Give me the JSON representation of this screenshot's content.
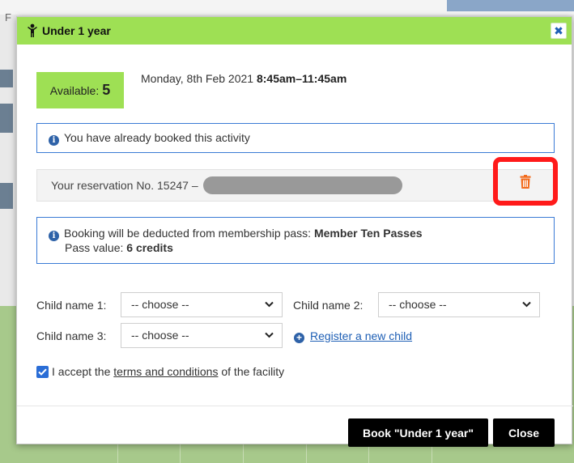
{
  "background": {
    "partial_text": "F",
    "grid_columns": 6
  },
  "dialog": {
    "title": "Under 1 year",
    "title_icon": "child-figure-icon",
    "close_icon": "close-x-icon",
    "available_label": "Available:",
    "available_count": "5",
    "date": "Monday, 8th Feb 2021",
    "time": "8:45am–11:45am",
    "already_booked": "You have already booked this activity",
    "reservation_text": "Your reservation No. 15247 –",
    "deduct_text": "Booking will be deducted from membership pass:",
    "pass_name": "Member Ten Passes",
    "pass_value_label": "Pass value:",
    "pass_value": "6 credits",
    "child1_label": "Child name 1:",
    "child2_label": "Child name 2:",
    "child3_label": "Child name 3:",
    "choose_placeholder": "-- choose --",
    "register_link": "Register a new child",
    "accept_prefix": "I accept the",
    "accept_link": "terms and conditions",
    "accept_suffix": "of the facility",
    "accept_checked": true,
    "book_button": "Book \"Under 1 year\"",
    "close_button": "Close"
  },
  "colors": {
    "accent_green": "#9ee054",
    "info_border": "#3a7bd5",
    "trash_orange": "#f26a1b",
    "highlight_red": "#ff1a1a",
    "link_blue": "#1e5fb5"
  }
}
